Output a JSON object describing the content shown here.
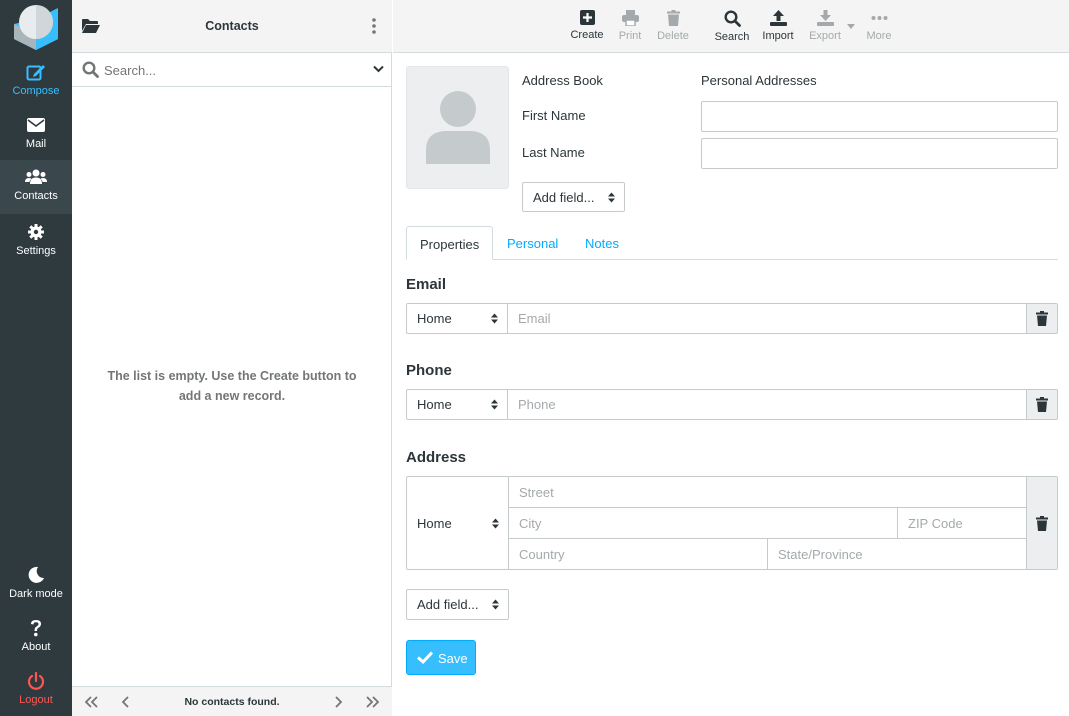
{
  "nav": {
    "items": [
      {
        "label": "Compose",
        "icon": "compose-icon",
        "color": "#37beff"
      },
      {
        "label": "Mail",
        "icon": "mail-icon"
      },
      {
        "label": "Contacts",
        "icon": "contacts-icon"
      },
      {
        "label": "Settings",
        "icon": "settings-icon"
      }
    ],
    "bottom": [
      {
        "label": "Dark mode",
        "icon": "moon-icon"
      },
      {
        "label": "About",
        "icon": "question-icon"
      },
      {
        "label": "Logout",
        "icon": "power-icon",
        "color": "#ff5552"
      }
    ]
  },
  "list": {
    "title": "Contacts",
    "search_placeholder": "Search...",
    "empty_message": "The list is empty. Use the Create button to add a new record.",
    "footer_count": "No contacts found."
  },
  "toolbar": {
    "create": "Create",
    "print": "Print",
    "delete": "Delete",
    "search": "Search",
    "import": "Import",
    "export": "Export",
    "more": "More"
  },
  "form": {
    "address_book_label": "Address Book",
    "address_book_value": "Personal Addresses",
    "first_name_label": "First Name",
    "first_name_value": "",
    "last_name_label": "Last Name",
    "last_name_value": "",
    "add_field_top": "Add field...",
    "tabs": [
      "Properties",
      "Personal",
      "Notes"
    ],
    "email": {
      "title": "Email",
      "type": "Home",
      "placeholder": "Email"
    },
    "phone": {
      "title": "Phone",
      "type": "Home",
      "placeholder": "Phone"
    },
    "address": {
      "title": "Address",
      "type": "Home",
      "street": "Street",
      "city": "City",
      "zip": "ZIP Code",
      "country": "Country",
      "state": "State/Province"
    },
    "add_field_bottom": "Add field...",
    "save": "Save"
  },
  "colors": {
    "accent": "#37beff",
    "nav_bg": "#2f3a3f",
    "logout": "#ff5552"
  }
}
